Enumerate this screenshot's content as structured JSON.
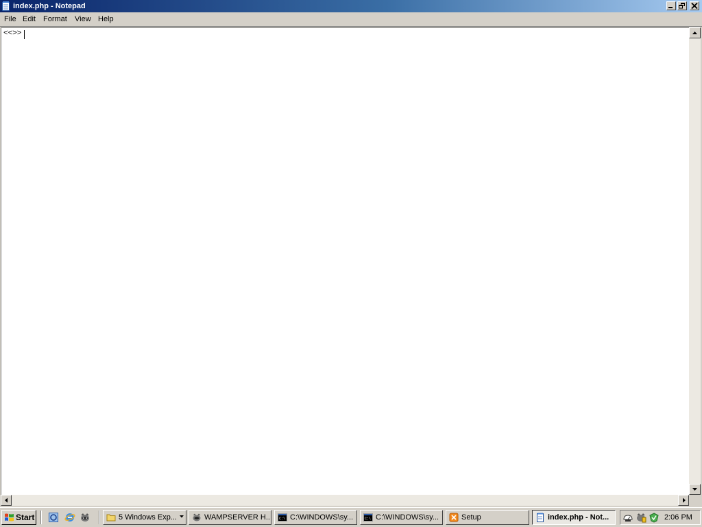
{
  "window": {
    "title": "index.php - Notepad",
    "controls": [
      "minimize",
      "restore",
      "close"
    ]
  },
  "menu": [
    "File",
    "Edit",
    "Format",
    "View",
    "Help"
  ],
  "editor": {
    "text": "<<>>"
  },
  "taskbar": {
    "start_label": "Start",
    "quick_launch": [
      "desktop-cleanup-icon",
      "internet-explorer-icon",
      "wampserver-icon"
    ],
    "tasks": [
      {
        "label": "5 Windows Exp...",
        "icon": "folder-icon",
        "active": false
      },
      {
        "label": "WAMPSERVER H...",
        "icon": "wampserver-icon",
        "active": false
      },
      {
        "label": "C:\\WINDOWS\\sy...",
        "icon": "cmd-icon",
        "active": false
      },
      {
        "label": "C:\\WINDOWS\\sy...",
        "icon": "cmd-icon",
        "active": false
      },
      {
        "label": "Setup",
        "icon": "setup-icon",
        "active": false
      },
      {
        "label": "index.php - Not...",
        "icon": "notepad-icon",
        "active": true
      }
    ],
    "tray_icons": [
      "network-icon",
      "wamp-tray-icon",
      "security-icon"
    ],
    "clock": "2:06 PM"
  },
  "colors": {
    "titlebar_start": "#0a246a",
    "titlebar_end": "#a6caf0",
    "chrome": "#d4d0c8"
  }
}
